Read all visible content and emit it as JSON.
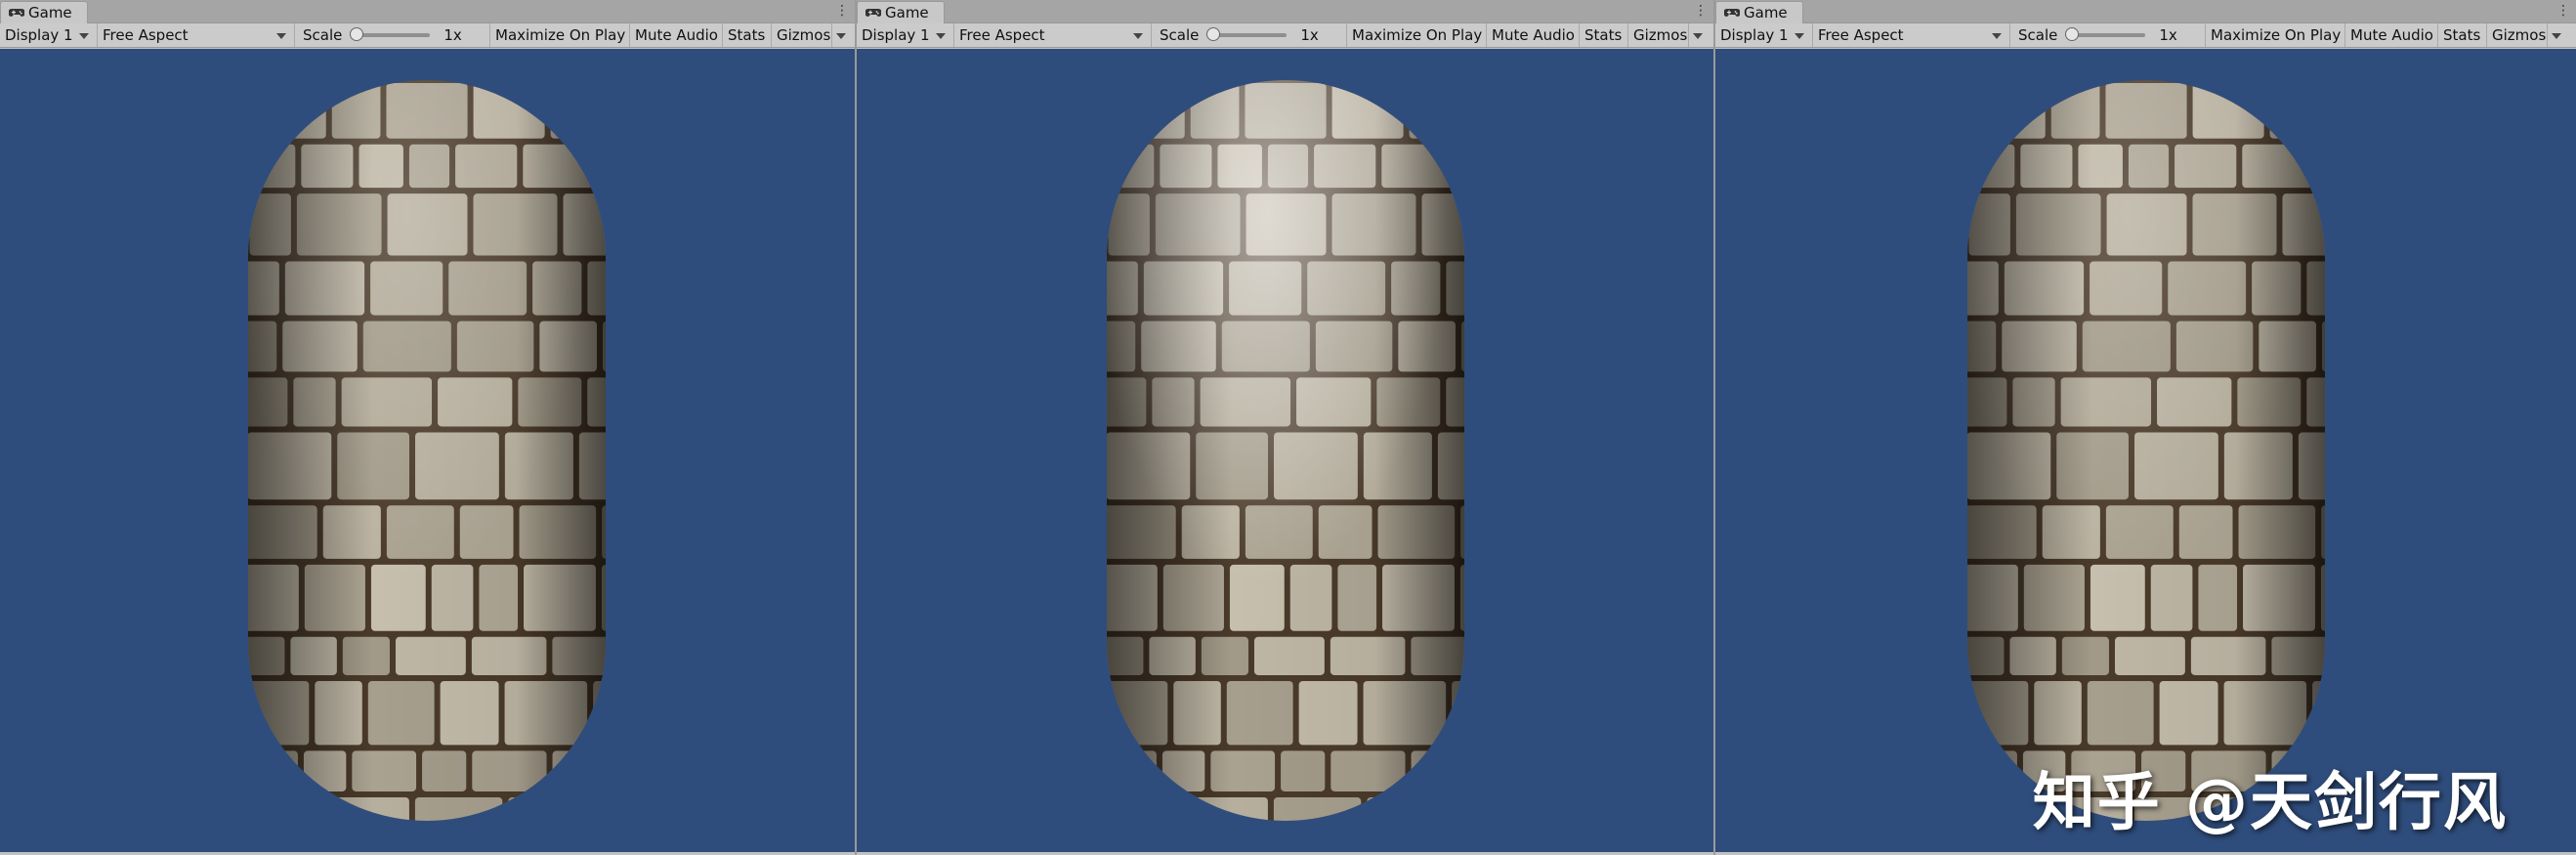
{
  "panels": [
    {
      "tab": {
        "label": "Game"
      },
      "toolbar": {
        "display": "Display 1",
        "aspect": "Free Aspect",
        "scale_label": "Scale",
        "scale_value": "1x",
        "maximize": "Maximize On Play",
        "mute": "Mute Audio",
        "stats": "Stats",
        "gizmos": "Gizmos"
      },
      "shading": "diffuse"
    },
    {
      "tab": {
        "label": "Game"
      },
      "toolbar": {
        "display": "Display 1",
        "aspect": "Free Aspect",
        "scale_label": "Scale",
        "scale_value": "1x",
        "maximize": "Maximize On Play",
        "mute": "Mute Audio",
        "stats": "Stats",
        "gizmos": "Gizmos"
      },
      "shading": "specular"
    },
    {
      "tab": {
        "label": "Game"
      },
      "toolbar": {
        "display": "Display 1",
        "aspect": "Free Aspect",
        "scale_label": "Scale",
        "scale_value": "1x",
        "maximize": "Maximize On Play",
        "mute": "Mute Audio",
        "stats": "Stats",
        "gizmos": "Gizmos"
      },
      "shading": "normal-mapped"
    }
  ],
  "watermark": "知乎 @天剑行风",
  "colors": {
    "viewport_bg": "#2f4d7c",
    "stone": "#b8ad98",
    "mortar": "#4a3a2a"
  }
}
